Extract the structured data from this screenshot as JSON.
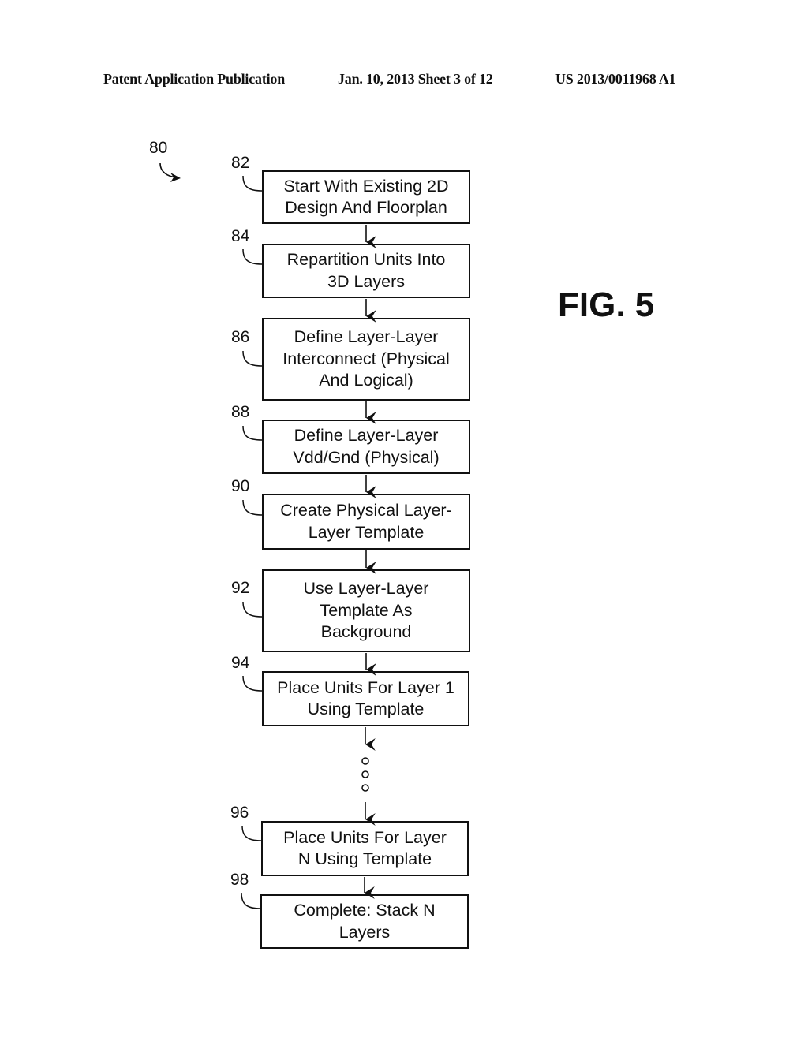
{
  "header": {
    "publication_type": "Patent Application Publication",
    "date_sheet": "Jan. 10, 2013  Sheet 3 of 12",
    "publication_number": "US 2013/0011968 A1"
  },
  "figure": {
    "label": "FIG. 5",
    "reference": "80",
    "steps": [
      {
        "ref": "82",
        "text": "Start With Existing 2D\nDesign And Floorplan"
      },
      {
        "ref": "84",
        "text": "Repartition Units Into\n3D Layers"
      },
      {
        "ref": "86",
        "text": "Define Layer-Layer\nInterconnect (Physical\nAnd Logical)"
      },
      {
        "ref": "88",
        "text": "Define Layer-Layer\nVdd/Gnd (Physical)"
      },
      {
        "ref": "90",
        "text": "Create Physical Layer-\nLayer Template"
      },
      {
        "ref": "92",
        "text": "Use Layer-Layer\nTemplate As\nBackground"
      },
      {
        "ref": "94",
        "text": "Place Units For Layer 1\nUsing Template"
      },
      {
        "ref": "96",
        "text": "Place Units For Layer\nN Using Template"
      },
      {
        "ref": "98",
        "text": "Complete:  Stack N\nLayers"
      }
    ],
    "continuation": "ellipsis-dots"
  }
}
